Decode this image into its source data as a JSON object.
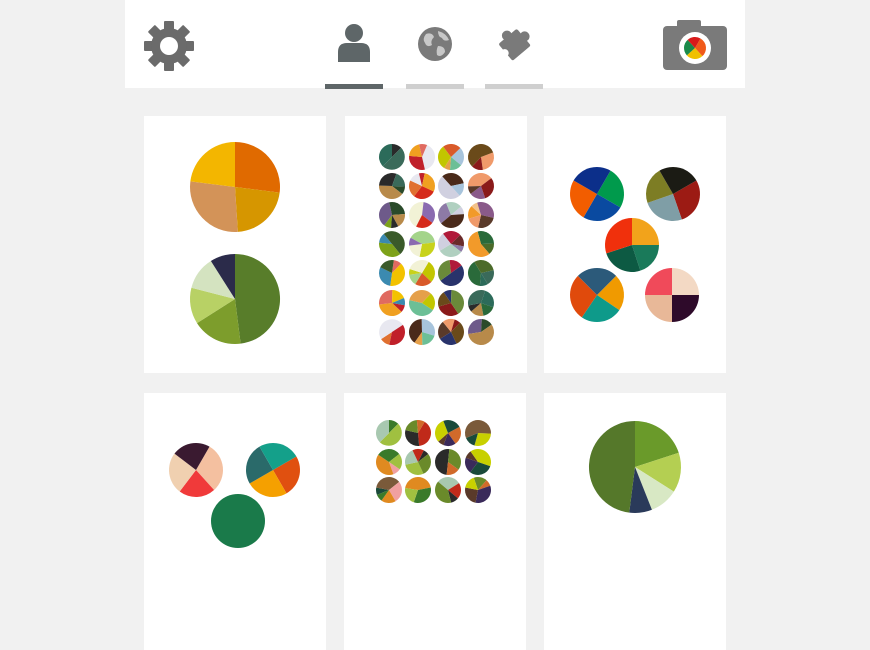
{
  "header": {
    "settings_icon": "gear-icon",
    "camera_icon": "camera-icon",
    "tabs": [
      {
        "id": "profile",
        "icon": "person-icon",
        "active": true
      },
      {
        "id": "world",
        "icon": "globe-icon",
        "active": false
      },
      {
        "id": "plugins",
        "icon": "puzzle-icon",
        "active": false
      }
    ],
    "colors": {
      "icon": "#6b6b6b",
      "active_tab_bar": "#5e6668",
      "inactive_tab_bar": "#cfcfcf"
    }
  },
  "cards": [
    {
      "name": "palette-card-1",
      "pies": [
        {
          "slices": [
            {
              "v": 0.27,
              "c": "#e06a00"
            },
            {
              "v": 0.22,
              "c": "#d69600"
            },
            {
              "v": 0.28,
              "c": "#d39358"
            },
            {
              "v": 0.23,
              "c": "#f3b600"
            }
          ]
        },
        {
          "slices": [
            {
              "v": 0.48,
              "c": "#587d2a"
            },
            {
              "v": 0.18,
              "c": "#7d9d2c"
            },
            {
              "v": 0.13,
              "c": "#b8d165"
            },
            {
              "v": 0.12,
              "c": "#d4e3c0"
            },
            {
              "v": 0.09,
              "c": "#2b2b4a"
            }
          ]
        }
      ]
    },
    {
      "name": "palette-card-2",
      "palette": [
        "#2a2a2a",
        "#c2c600",
        "#4c6b2a",
        "#f2f2d6",
        "#5a3a2a",
        "#e8e8f0",
        "#29336b",
        "#f3c200",
        "#8d7aa6",
        "#6e5a8a",
        "#a7c4dc",
        "#3a6a5a",
        "#d95a2a",
        "#f29a2a",
        "#8a6ab0",
        "#f09a6a",
        "#c0202a",
        "#6a8a3a",
        "#3b8ab0",
        "#b0d0c0",
        "#2a4a2a",
        "#6cbf96",
        "#2c6b5a",
        "#a4d48a",
        "#f3c28a",
        "#d52a1a",
        "#8a1a1a",
        "#f0a020",
        "#b01a3a",
        "#3a5a2a",
        "#d0d0e0",
        "#b88a4a",
        "#e5a04a",
        "#2a6a3a",
        "#c8d21a",
        "#8a5a8a",
        "#e07030",
        "#6a4a1a",
        "#e06a60",
        "#6a2a2a",
        "#7da21a",
        "#4a2a1a"
      ],
      "pies": []
    },
    {
      "name": "palette-card-3",
      "pies": [
        {
          "slices": [
            {
              "v": 0.25,
              "c": "#009a4c"
            },
            {
              "v": 0.25,
              "c": "#0a4aa0"
            },
            {
              "v": 0.25,
              "c": "#f25d00"
            },
            {
              "v": 0.25,
              "c": "#0c2f8a"
            }
          ]
        },
        {
          "slices": [
            {
              "v": 0.28,
              "c": "#9c1b14"
            },
            {
              "v": 0.25,
              "c": "#7f9ea6"
            },
            {
              "v": 0.22,
              "c": "#7d7d24"
            },
            {
              "v": 0.25,
              "c": "#1b1b14"
            }
          ]
        },
        {
          "slices": [
            {
              "v": 0.25,
              "c": "#f2a31b"
            },
            {
              "v": 0.2,
              "c": "#1a7a5a"
            },
            {
              "v": 0.25,
              "c": "#0d5a43"
            },
            {
              "v": 0.3,
              "c": "#f0300c"
            }
          ]
        },
        {
          "slices": [
            {
              "v": 0.22,
              "c": "#f09a00"
            },
            {
              "v": 0.25,
              "c": "#0e9a8a"
            },
            {
              "v": 0.28,
              "c": "#e04a0c"
            },
            {
              "v": 0.25,
              "c": "#2c5a7a"
            }
          ]
        },
        {
          "slices": [
            {
              "v": 0.25,
              "c": "#f3d9c4"
            },
            {
              "v": 0.25,
              "c": "#2e0a2a"
            },
            {
              "v": 0.25,
              "c": "#e8b898"
            },
            {
              "v": 0.25,
              "c": "#f04a5a"
            }
          ]
        }
      ]
    },
    {
      "name": "palette-card-4",
      "pies": [
        {
          "slices": [
            {
              "v": 0.3,
              "c": "#f4c0a0"
            },
            {
              "v": 0.22,
              "c": "#f03a3a"
            },
            {
              "v": 0.25,
              "c": "#f0d0b0"
            },
            {
              "v": 0.23,
              "c": "#3a1a30"
            }
          ]
        },
        {
          "slices": [
            {
              "v": 0.25,
              "c": "#e05010"
            },
            {
              "v": 0.25,
              "c": "#f5a000"
            },
            {
              "v": 0.25,
              "c": "#2a6a6a"
            },
            {
              "v": 0.25,
              "c": "#14a08a"
            }
          ]
        },
        {
          "slices": [
            {
              "v": 1.0,
              "c": "#1a7a4a"
            }
          ]
        }
      ]
    },
    {
      "name": "palette-card-5",
      "palette": [
        "#3a7a2a",
        "#c8d000",
        "#2a2a2a",
        "#e08a20",
        "#5a3a2a",
        "#c02a1a",
        "#f0a0a0",
        "#3a2a5a",
        "#a8c8b0",
        "#7a5a3a",
        "#d06a2a",
        "#a0c040",
        "#1a4a3a",
        "#6a8a2a"
      ],
      "pies": []
    },
    {
      "name": "palette-card-6",
      "pies": [
        {
          "slices": [
            {
              "v": 0.2,
              "c": "#6a9a2a"
            },
            {
              "v": 0.14,
              "c": "#b4cf52"
            },
            {
              "v": 0.1,
              "c": "#d8e8c4"
            },
            {
              "v": 0.08,
              "c": "#2a3a5a"
            },
            {
              "v": 0.48,
              "c": "#55782a"
            }
          ]
        }
      ]
    }
  ]
}
